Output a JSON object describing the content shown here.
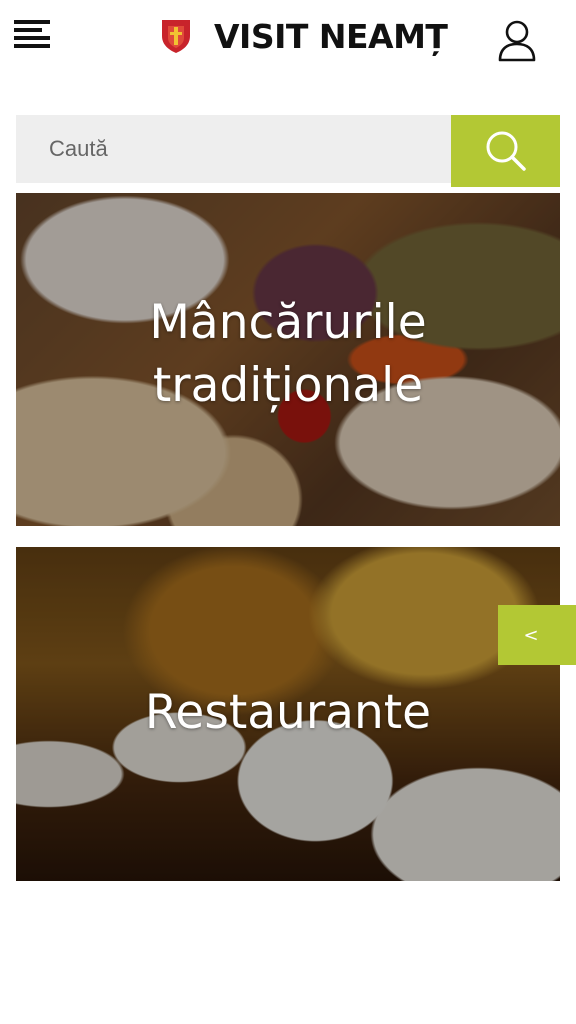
{
  "header": {
    "logo_text": "VISIT NEAMȚ",
    "menu_icon": "hamburger-menu-icon",
    "crest_icon": "coat-of-arms-icon",
    "user_icon": "user-icon"
  },
  "search": {
    "placeholder": "Caută",
    "button_icon": "search-icon"
  },
  "cards": [
    {
      "title": "Mâncărurile tradiționale"
    },
    {
      "title": "Restaurante"
    }
  ],
  "side_tab": {
    "label": "<"
  },
  "colors": {
    "accent": "#b3c834",
    "search_bg": "#eeeeee",
    "text": "#111111"
  }
}
